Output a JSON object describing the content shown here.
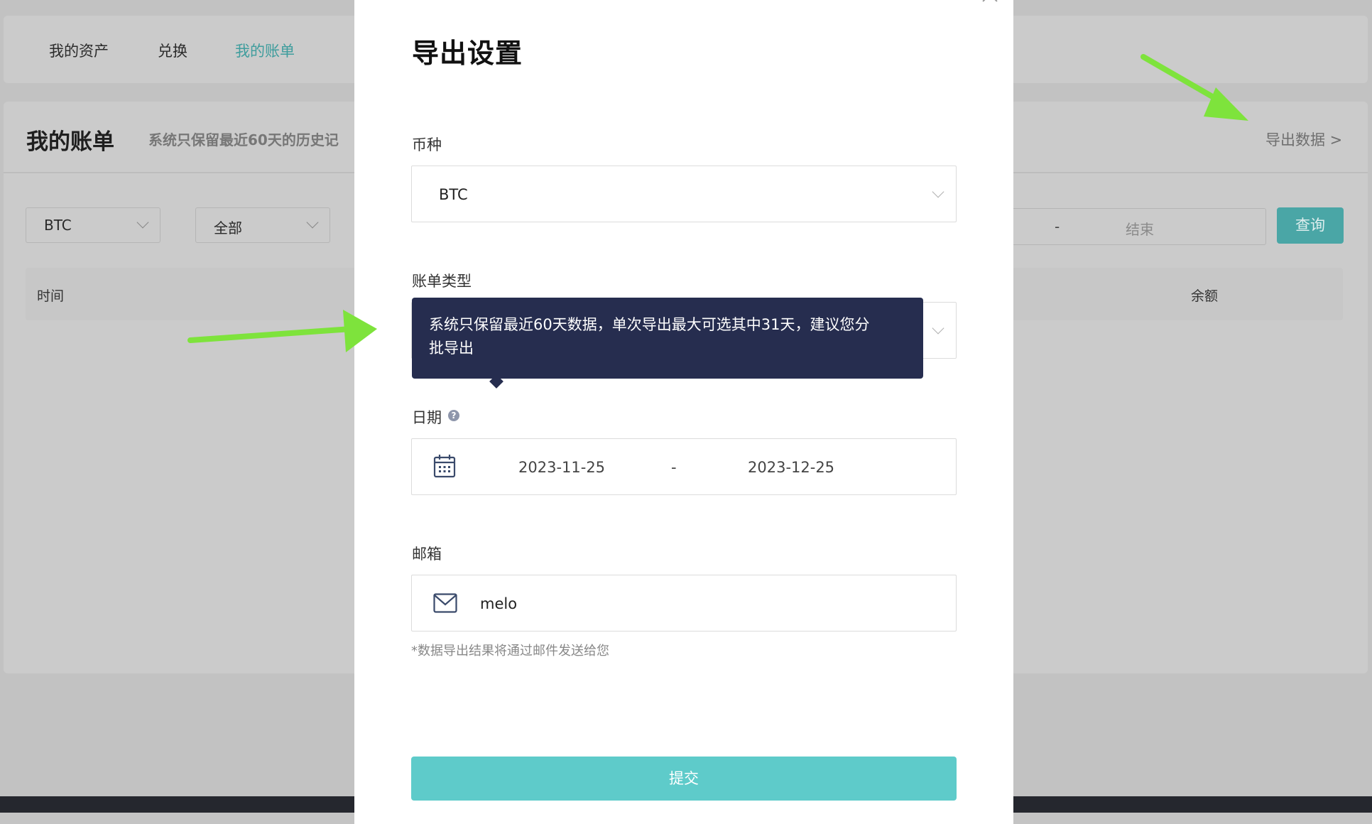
{
  "background": {
    "nav": [
      "我的资产",
      "兑换",
      "我的账单"
    ],
    "page_title": "我的账单",
    "page_note": "系统只保留最近60天的历史记",
    "export_link": "导出数据 >",
    "filters": {
      "coin": "BTC",
      "type": "全部",
      "dash": "-",
      "end_placeholder": "结束",
      "query_button": "查询"
    },
    "table_headers": [
      "时间",
      "余额"
    ]
  },
  "modal": {
    "title": "导出设置",
    "coin_label": "币种",
    "coin_value": "BTC",
    "type_label": "账单类型",
    "date_label": "日期",
    "date_help_icon": "?",
    "date_start": "2023-11-25",
    "date_sep": "-",
    "date_end": "2023-12-25",
    "email_label": "邮箱",
    "email_value": "melo",
    "hint": "*数据导出结果将通过邮件发送给您",
    "submit": "提交",
    "tooltip_line1": "系统只保留最近60天数据，单次导出最大可选其中31天，建议您分",
    "tooltip_line2": "批导出"
  },
  "colors": {
    "accent": "#5ecbca",
    "tooltip_bg": "#262d4f",
    "annotation_arrow": "#7ee33c"
  }
}
